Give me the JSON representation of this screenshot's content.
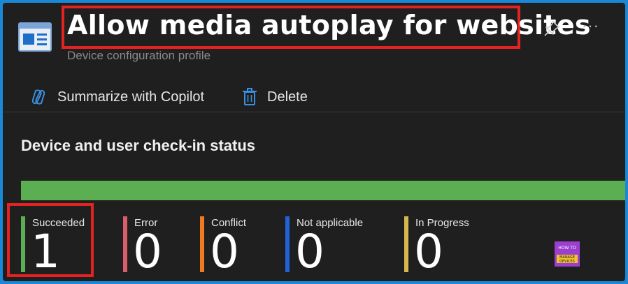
{
  "header": {
    "title": "Allow media autoplay for websites",
    "subtitle": "Device configuration profile",
    "pin_icon": "pin-icon",
    "more_label": "···"
  },
  "toolbar": {
    "summarize_label": "Summarize with Copilot",
    "delete_label": "Delete"
  },
  "section": {
    "title": "Device and user check-in status"
  },
  "stats": [
    {
      "label": "Succeeded",
      "value": "1",
      "color": "#5cae52"
    },
    {
      "label": "Error",
      "value": "0",
      "color": "#d85e6a"
    },
    {
      "label": "Conflict",
      "value": "0",
      "color": "#ef7a21"
    },
    {
      "label": "Not applicable",
      "value": "0",
      "color": "#1f63d6"
    },
    {
      "label": "In Progress",
      "value": "0",
      "color": "#d7b84d"
    }
  ],
  "logo": {
    "text_lines": [
      "HOW TO",
      "MANAGE",
      "DEVICES"
    ]
  },
  "colors": {
    "accent": "#1a88d6",
    "highlight": "#e32222",
    "status_bar": "#5cae52"
  }
}
